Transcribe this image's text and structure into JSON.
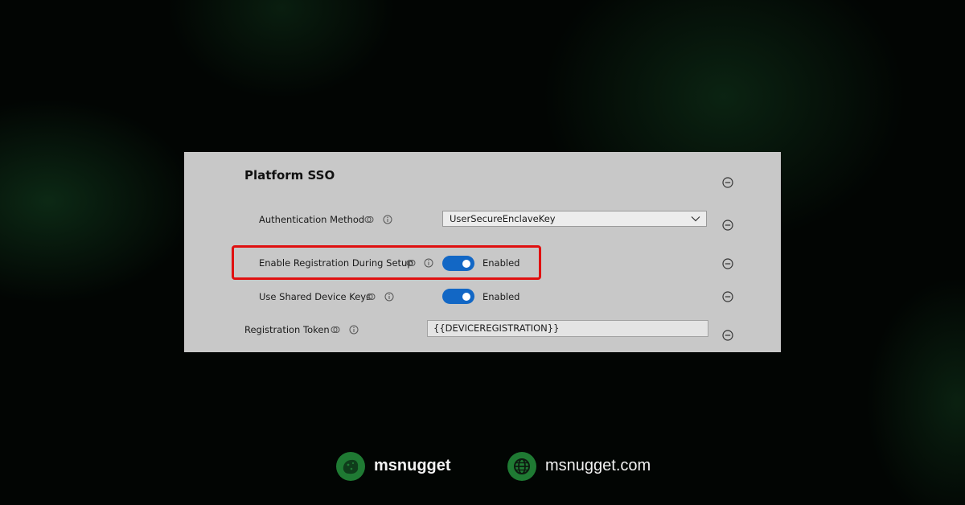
{
  "panel": {
    "title": "Platform SSO",
    "rows": {
      "auth_method": {
        "label": "Authentication Method",
        "value": "UserSecureEnclaveKey"
      },
      "enable_registration": {
        "label": "Enable Registration During Setup",
        "state": "Enabled"
      },
      "shared_keys": {
        "label": "Use Shared Device Keys",
        "state": "Enabled"
      },
      "registration_token": {
        "label": "Registration Token",
        "value": "{{DEVICEREGISTRATION}}"
      }
    }
  },
  "footer": {
    "brand": "msnugget",
    "website": "msnugget.com"
  },
  "colors": {
    "toggle_on": "#1267c5",
    "highlight": "#e01010",
    "brand_green": "#1f7a33"
  }
}
